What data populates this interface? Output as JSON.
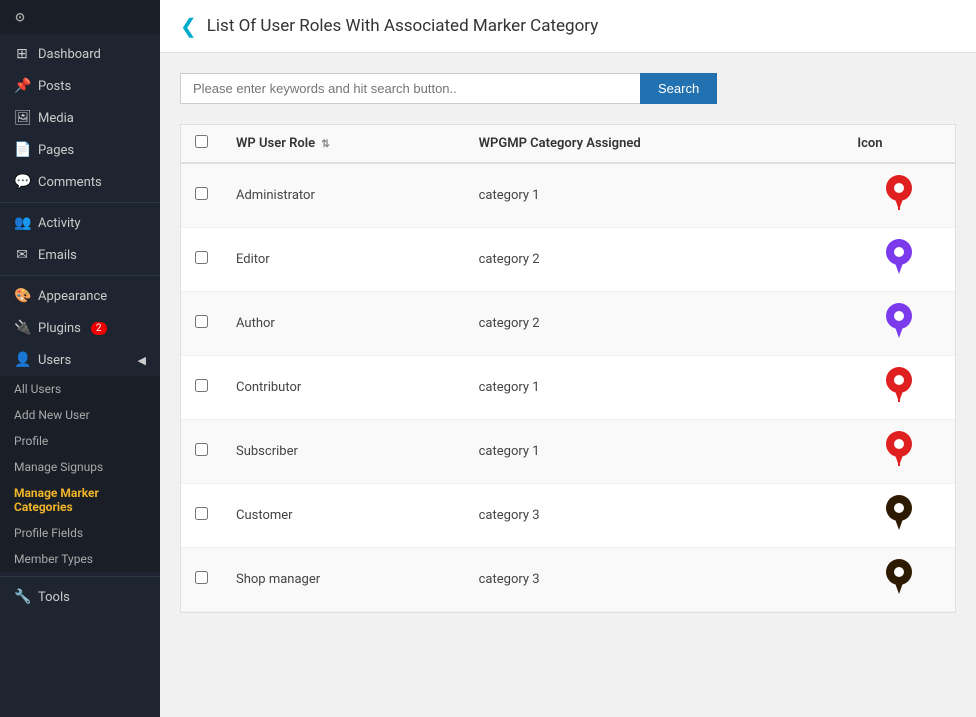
{
  "sidebar": {
    "logo": "WordPress",
    "items": [
      {
        "id": "dashboard",
        "label": "Dashboard",
        "icon": "⊞"
      },
      {
        "id": "posts",
        "label": "Posts",
        "icon": "📌"
      },
      {
        "id": "media",
        "label": "Media",
        "icon": "🖼"
      },
      {
        "id": "pages",
        "label": "Pages",
        "icon": "📄"
      },
      {
        "id": "comments",
        "label": "Comments",
        "icon": "💬"
      },
      {
        "id": "activity",
        "label": "Activity",
        "icon": "👥"
      },
      {
        "id": "emails",
        "label": "Emails",
        "icon": "✉"
      },
      {
        "id": "appearance",
        "label": "Appearance",
        "icon": "🎨"
      },
      {
        "id": "plugins",
        "label": "Plugins",
        "icon": "🔌",
        "badge": "2"
      },
      {
        "id": "users",
        "label": "Users",
        "icon": "👤"
      }
    ],
    "users_submenu": [
      {
        "id": "all-users",
        "label": "All Users"
      },
      {
        "id": "add-new-user",
        "label": "Add New User"
      },
      {
        "id": "profile",
        "label": "Profile"
      },
      {
        "id": "manage-signups",
        "label": "Manage Signups"
      },
      {
        "id": "manage-marker-categories",
        "label": "Manage Marker Categories",
        "active": true
      },
      {
        "id": "profile-fields",
        "label": "Profile Fields"
      },
      {
        "id": "member-types",
        "label": "Member Types"
      }
    ],
    "tools": {
      "label": "Tools",
      "icon": "🔧"
    }
  },
  "page": {
    "title": "List Of User Roles With Associated Marker Category",
    "icon": "❮"
  },
  "search": {
    "placeholder": "Please enter keywords and hit search button..",
    "button_label": "Search"
  },
  "table": {
    "columns": [
      {
        "id": "checkbox",
        "label": ""
      },
      {
        "id": "wp_user_role",
        "label": "WP User Role",
        "sortable": true
      },
      {
        "id": "wpgmp_category",
        "label": "WPGMP Category Assigned"
      },
      {
        "id": "icon",
        "label": "Icon"
      }
    ],
    "rows": [
      {
        "id": 1,
        "role": "Administrator",
        "category": "category 1",
        "icon_color": "red"
      },
      {
        "id": 2,
        "role": "Editor",
        "category": "category 2",
        "icon_color": "purple"
      },
      {
        "id": 3,
        "role": "Author",
        "category": "category 2",
        "icon_color": "purple"
      },
      {
        "id": 4,
        "role": "Contributor",
        "category": "category 1",
        "icon_color": "red"
      },
      {
        "id": 5,
        "role": "Subscriber",
        "category": "category 1",
        "icon_color": "red"
      },
      {
        "id": 6,
        "role": "Customer",
        "category": "category 3",
        "icon_color": "dark"
      },
      {
        "id": 7,
        "role": "Shop manager",
        "category": "category 3",
        "icon_color": "dark"
      }
    ]
  }
}
